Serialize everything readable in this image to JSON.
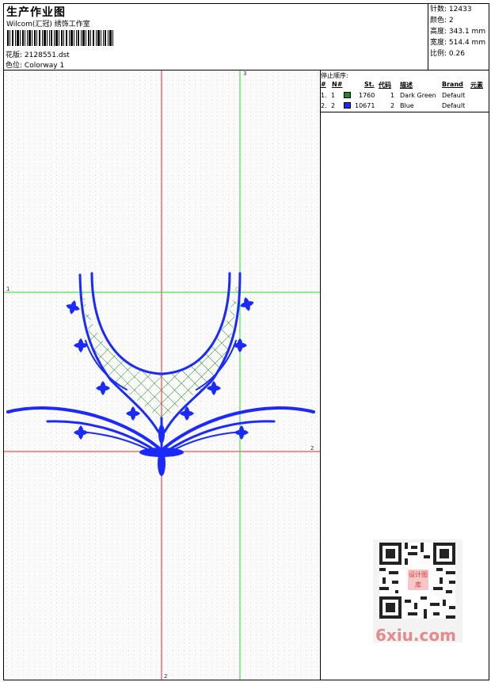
{
  "header": {
    "title": "生产作业图",
    "studio": "Wilcom(汇冠) 绣饰工作室",
    "design_label": "花版:",
    "design_value": "2128551.dst",
    "colorway_label": "色位:",
    "colorway_value": "Colorway 1"
  },
  "stats": [
    {
      "label": "针数:",
      "value": "12433"
    },
    {
      "label": "颜色:",
      "value": "2"
    },
    {
      "label": "高度:",
      "value": "343.1 mm"
    },
    {
      "label": "宽度:",
      "value": "514.4 mm"
    },
    {
      "label": "比例:",
      "value": "0.26"
    }
  ],
  "guides": {
    "labels": [
      "3",
      "1",
      "2",
      "2"
    ]
  },
  "color_table": {
    "stop_label": "停止顺序:",
    "headers": [
      "#",
      "N#",
      "St.",
      "代码",
      "描述",
      "Brand",
      "元素"
    ],
    "rows": [
      {
        "idx": "1.",
        "n": "1",
        "swatch": "#1f8a1f",
        "st": "1760",
        "code": "1",
        "desc": "Dark Green",
        "brand": "Default"
      },
      {
        "idx": "2.",
        "n": "2",
        "swatch": "#1a2aff",
        "st": "10671",
        "code": "2",
        "desc": "Blue",
        "brand": "Default"
      }
    ]
  },
  "watermark": {
    "site": "6xiu.com",
    "badge": "设计图库"
  },
  "colors": {
    "embroidery_blue": "#1a2aff",
    "fill_green": "#1f8a1f",
    "guide_red": "#ff2020",
    "guide_green": "#20dd20"
  }
}
